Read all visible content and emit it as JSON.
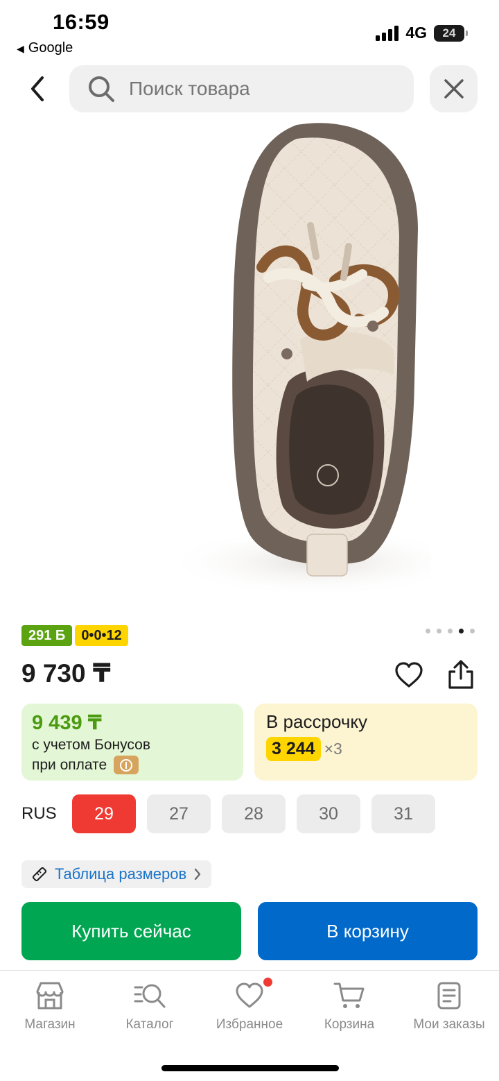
{
  "status_bar": {
    "time": "16:59",
    "back_app": "Google",
    "network": "4G",
    "battery": "24"
  },
  "header": {
    "back_icon": "chevron-left-icon",
    "search_placeholder": "Поиск товара",
    "search_icon": "search-icon",
    "close_icon": "close-icon"
  },
  "product": {
    "image_alt": "shoe-photo",
    "pager": {
      "count": 5,
      "active_index": 3
    },
    "bonus_badge": "291 Б",
    "installment_badge": "0•0•12",
    "price": "9 730 ₸"
  },
  "offers": {
    "bonus": {
      "amount": "9 439 ₸",
      "line1": "с учетом Бонусов",
      "line2": "при оплате"
    },
    "installment": {
      "title": "В рассрочку",
      "amount": "3 244",
      "times": "×3"
    }
  },
  "sizes": {
    "label": "RUS",
    "options": [
      "29",
      "27",
      "28",
      "30",
      "31"
    ],
    "selected": "29",
    "size_table_label": "Таблица размеров"
  },
  "actions": {
    "buy_now": "Купить сейчас",
    "add_to_cart": "В корзину"
  },
  "tab_bar": {
    "items": [
      {
        "label": "Магазин",
        "icon": "store-icon"
      },
      {
        "label": "Каталог",
        "icon": "catalog-search-icon"
      },
      {
        "label": "Избранное",
        "icon": "heart-icon",
        "has_notification": true
      },
      {
        "label": "Корзина",
        "icon": "cart-icon"
      },
      {
        "label": "Мои заказы",
        "icon": "orders-icon"
      }
    ]
  },
  "colors": {
    "accent_red": "#ef3a33",
    "buy_green": "#00a651",
    "cart_blue": "#0069c9",
    "bonus_green": "#5ba310",
    "installment_yellow": "#ffd500"
  }
}
